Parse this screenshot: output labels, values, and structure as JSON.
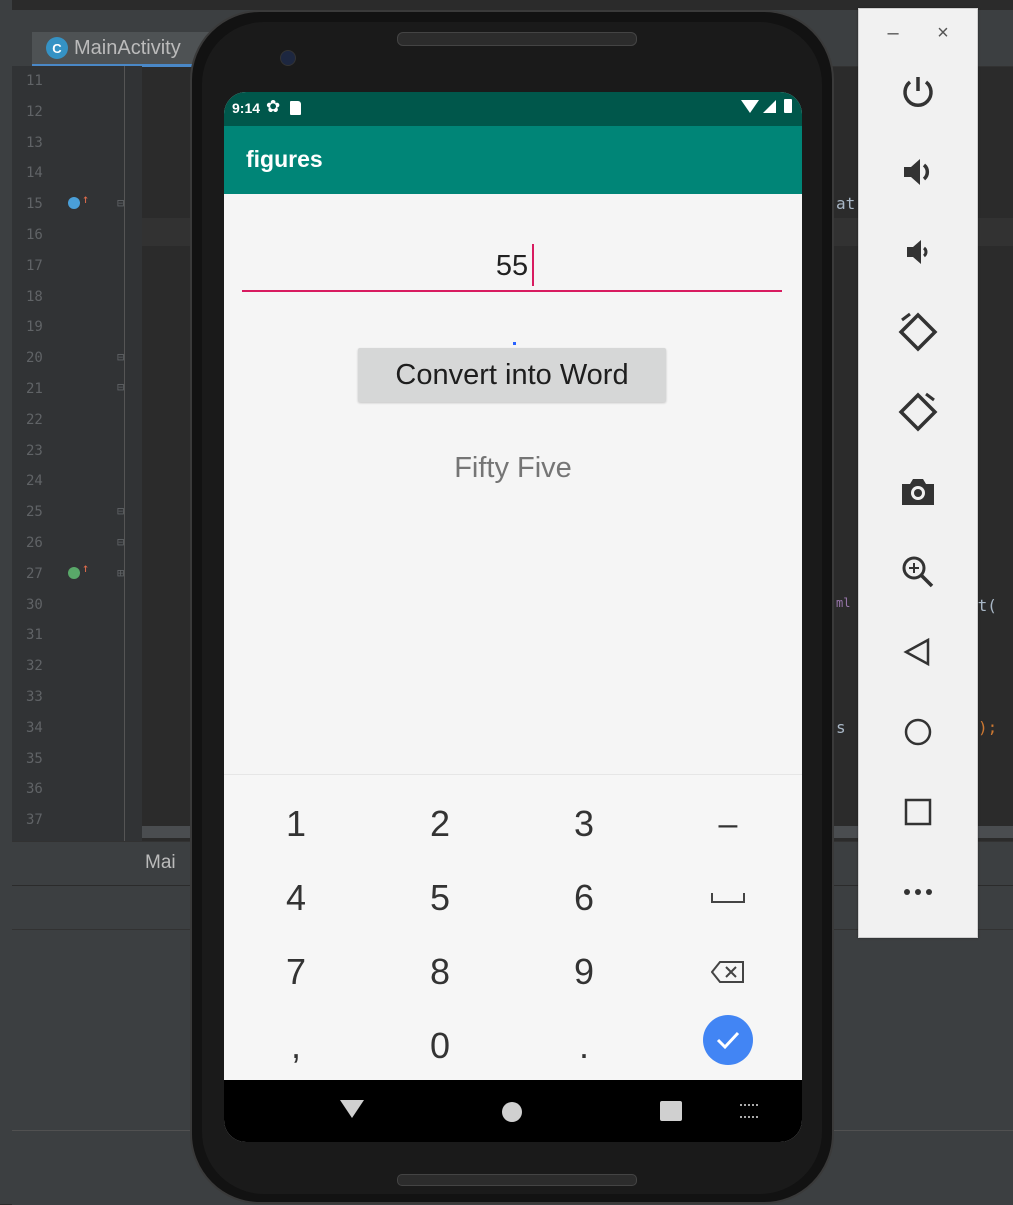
{
  "ide": {
    "tab_label": "MainActivity",
    "tab_icon": "C",
    "line_numbers": [
      "11",
      "12",
      "13",
      "14",
      "15",
      "16",
      "17",
      "18",
      "19",
      "20",
      "21",
      "22",
      "23",
      "24",
      "25",
      "26",
      "27",
      "30",
      "31",
      "32",
      "33",
      "34",
      "35",
      "36",
      "37"
    ],
    "code_fragments": [
      "at",
      "xt(",
      "s",
      ");",
      "ml"
    ],
    "bottom_label": "Mai"
  },
  "phone": {
    "status_time": "9:14",
    "app_title": "figures",
    "input_value": "55",
    "convert_button_label": "Convert into Word",
    "result_text": "Fifty Five",
    "keyboard": {
      "row1": [
        "1",
        "2",
        "3",
        "–"
      ],
      "row2": [
        "4",
        "5",
        "6"
      ],
      "row3": [
        "7",
        "8",
        "9"
      ],
      "row4": [
        ",",
        "0",
        "."
      ]
    }
  },
  "emulator_toolbar": {
    "minimize": "–",
    "close": "×",
    "buttons": [
      "power-icon",
      "volume-up-icon",
      "volume-down-icon",
      "rotate-left-icon",
      "rotate-right-icon",
      "camera-icon",
      "zoom-icon",
      "back-icon",
      "home-icon",
      "overview-icon",
      "more-icon"
    ]
  },
  "colors": {
    "status_bar": "#00574b",
    "app_bar": "#008577",
    "accent": "#d81b60",
    "done_button": "#4285f4"
  }
}
